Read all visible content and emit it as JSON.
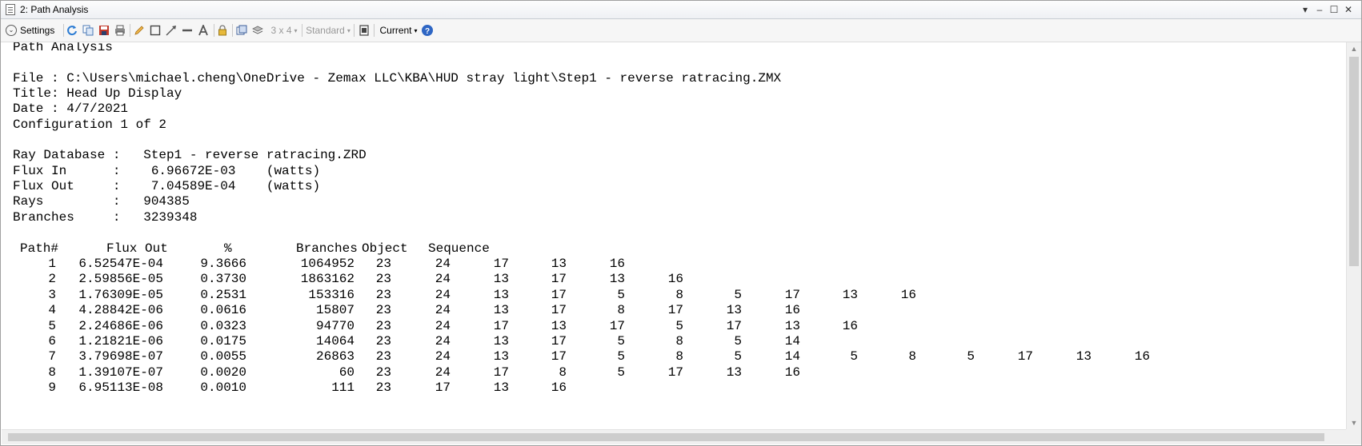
{
  "window": {
    "title": "2: Path Analysis",
    "controls": {
      "menu": "▾",
      "minimize": "–",
      "maximize": "☐",
      "close": "✕"
    }
  },
  "toolbar": {
    "settings_label": "Settings",
    "layout_label": "3 x 4",
    "standard_label": "Standard",
    "current_label": "Current",
    "icons": [
      "refresh-icon",
      "copy-icon",
      "save-icon",
      "print-icon",
      "pencil-icon",
      "rectangle-icon",
      "line-arrow-icon",
      "line-icon",
      "text-icon",
      "lock-icon",
      "window-icon",
      "layers-icon",
      "fit-icon",
      "help-icon"
    ]
  },
  "report": {
    "heading": "Path Analysis",
    "file": "File : C:\\Users\\michael.cheng\\OneDrive - Zemax LLC\\KBA\\HUD stray light\\Step1 - reverse ratracing.ZMX",
    "title": "Title: Head Up Display",
    "date": "Date : 4/7/2021",
    "config": "Configuration 1 of 2",
    "ray_database": "Ray Database :   Step1 - reverse ratracing.ZRD",
    "flux_in": "Flux In      :    6.96672E-03    (watts)",
    "flux_out": "Flux Out     :    7.04589E-04    (watts)",
    "rays": "Rays         :   904385",
    "branches": "Branches     :   3239348",
    "table_headers": {
      "path": "Path#",
      "flux_out": "Flux Out",
      "percent": "%",
      "branches": "Branches",
      "object": "Object",
      "sequence": "Sequence"
    },
    "rows": [
      {
        "path": "1",
        "flux": "6.52547E-04",
        "pct": "9.3666",
        "branches": "1064952",
        "object": "23",
        "seq": [
          "24",
          "17",
          "13",
          "16"
        ]
      },
      {
        "path": "2",
        "flux": "2.59856E-05",
        "pct": "0.3730",
        "branches": "1863162",
        "object": "23",
        "seq": [
          "24",
          "13",
          "17",
          "13",
          "16"
        ]
      },
      {
        "path": "3",
        "flux": "1.76309E-05",
        "pct": "0.2531",
        "branches": "153316",
        "object": "23",
        "seq": [
          "24",
          "13",
          "17",
          "5",
          "8",
          "5",
          "17",
          "13",
          "16"
        ]
      },
      {
        "path": "4",
        "flux": "4.28842E-06",
        "pct": "0.0616",
        "branches": "15807",
        "object": "23",
        "seq": [
          "24",
          "13",
          "17",
          "8",
          "17",
          "13",
          "16"
        ]
      },
      {
        "path": "5",
        "flux": "2.24686E-06",
        "pct": "0.0323",
        "branches": "94770",
        "object": "23",
        "seq": [
          "24",
          "17",
          "13",
          "17",
          "5",
          "17",
          "13",
          "16"
        ]
      },
      {
        "path": "6",
        "flux": "1.21821E-06",
        "pct": "0.0175",
        "branches": "14064",
        "object": "23",
        "seq": [
          "24",
          "13",
          "17",
          "5",
          "8",
          "5",
          "14"
        ]
      },
      {
        "path": "7",
        "flux": "3.79698E-07",
        "pct": "0.0055",
        "branches": "26863",
        "object": "23",
        "seq": [
          "24",
          "13",
          "17",
          "5",
          "8",
          "5",
          "14",
          "5",
          "8",
          "5",
          "17",
          "13",
          "16"
        ]
      },
      {
        "path": "8",
        "flux": "1.39107E-07",
        "pct": "0.0020",
        "branches": "60",
        "object": "23",
        "seq": [
          "24",
          "17",
          "8",
          "5",
          "17",
          "13",
          "16"
        ]
      },
      {
        "path": "9",
        "flux": "6.95113E-08",
        "pct": "0.0010",
        "branches": "111",
        "object": "23",
        "seq": [
          "17",
          "13",
          "16"
        ]
      }
    ]
  },
  "colors": {
    "help": "#2e66c4",
    "refresh": "#2a7bd3",
    "save": "#c0392b"
  }
}
